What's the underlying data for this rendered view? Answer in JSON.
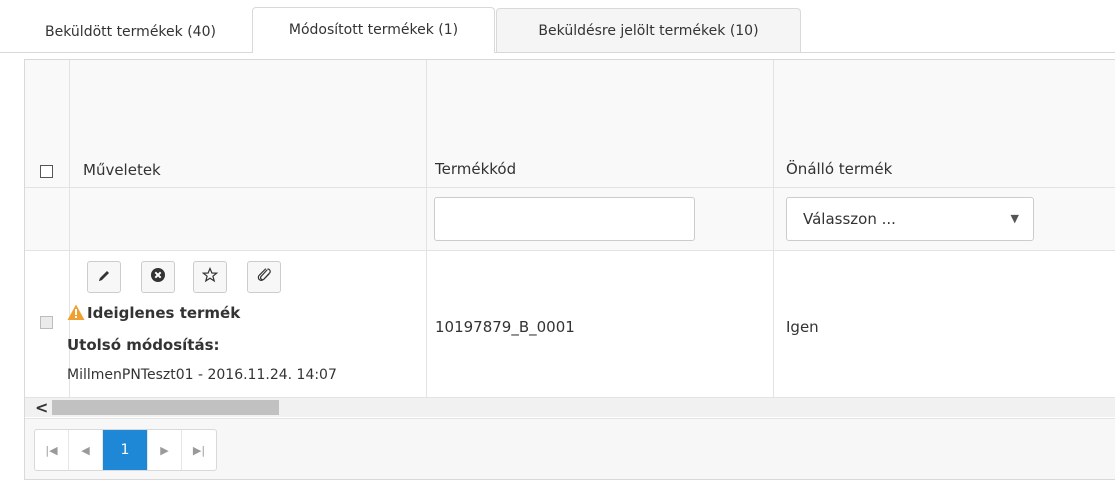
{
  "tabs": [
    {
      "label": "Beküldött termékek (40)"
    },
    {
      "label": "Módosított termékek (1)"
    },
    {
      "label": "Beküldésre jelölt termékek (10)"
    }
  ],
  "grid": {
    "columns": {
      "actions": "Műveletek",
      "code": "Termékkód",
      "standalone": "Önálló termék"
    },
    "filters": {
      "code_value": "",
      "standalone_select": "Válasszon ..."
    },
    "rows": [
      {
        "warning": "Ideiglenes termék",
        "last_modified_label": "Utolsó módosítás:",
        "last_modified_value": "MillmenPNTeszt01 - 2016.11.24. 14:07",
        "code": "10197879_B_0001",
        "standalone": "Igen"
      }
    ]
  },
  "icons": {
    "edit": "pencil-icon",
    "remove": "close-circle-icon",
    "favorite": "star-icon",
    "attach": "paperclip-icon",
    "warning": "warning-triangle-icon",
    "scroll_left": "chevron-left-icon"
  },
  "pager": {
    "current_page": "1"
  },
  "colors": {
    "accent": "#1e88d6",
    "warning": "#f0a030"
  }
}
